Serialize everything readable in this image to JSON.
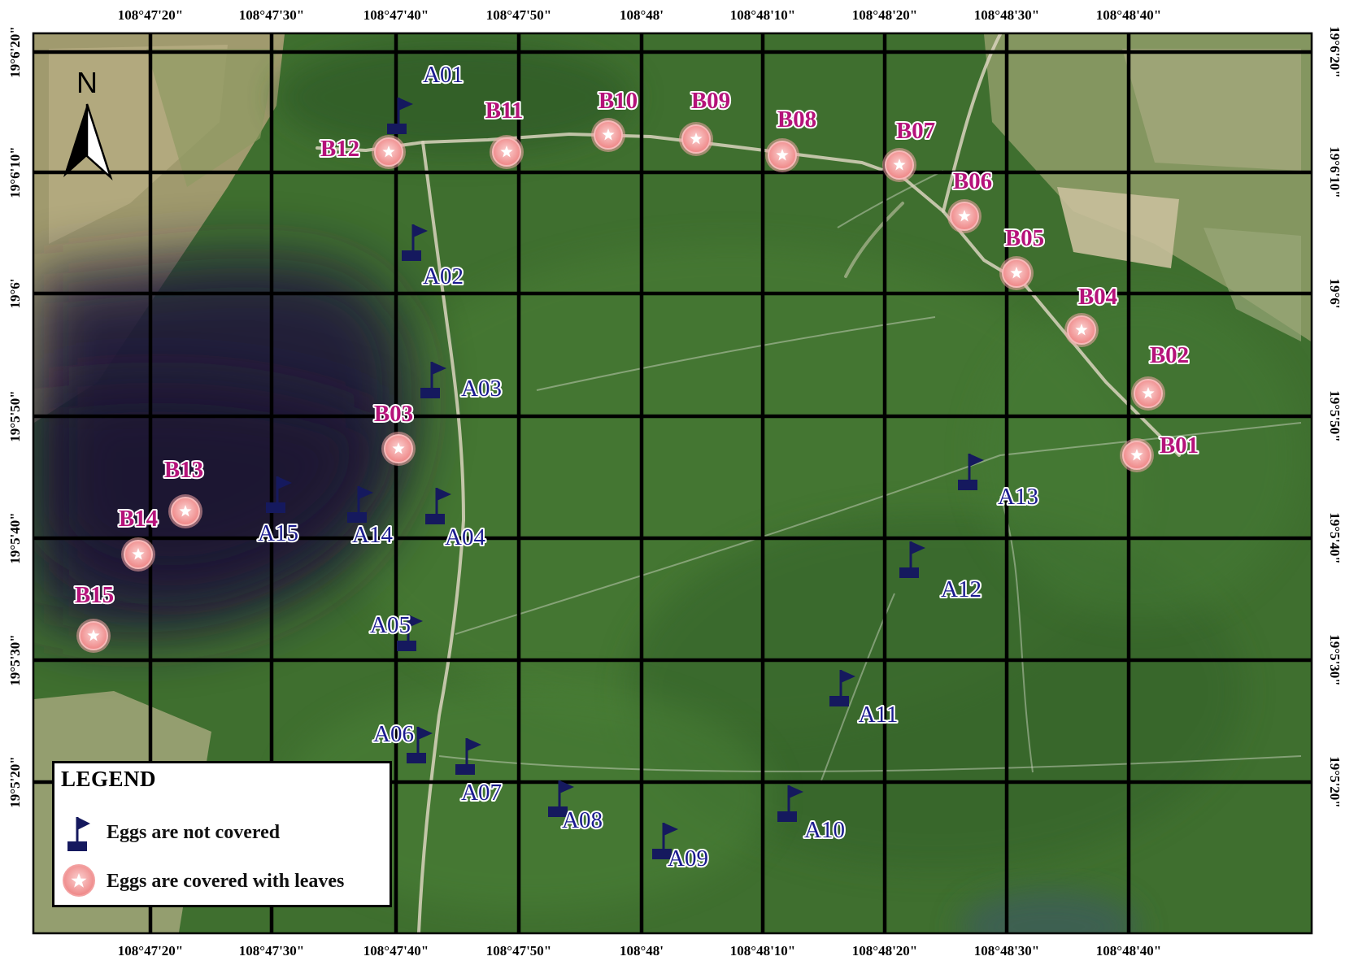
{
  "map": {
    "longitude_labels": [
      "108°47'20\"",
      "108°47'30\"",
      "108°47'40\"",
      "108°47'50\"",
      "108°48'",
      "108°48'10\"",
      "108°48'20\"",
      "108°48'30\"",
      "108°48'40\""
    ],
    "latitude_labels": [
      "19°6'20\"",
      "19°6'10\"",
      "19°6'",
      "19°5'50\"",
      "19°5'40\"",
      "19°5'30\"",
      "19°5'20\""
    ],
    "north_label": "N",
    "colors": {
      "satellite_green": "#3f6f2f",
      "shaded_area": "#241d3a",
      "flag": "#15195e",
      "marker": "#f08b8b",
      "marker_label": "#b5127a",
      "flag_label": "#1b1b8f",
      "grid": "#000000"
    }
  },
  "sites_not_covered": [
    {
      "id": "A01",
      "label": "A01",
      "icon": "flag-icon"
    },
    {
      "id": "A02",
      "label": "A02",
      "icon": "flag-icon"
    },
    {
      "id": "A03",
      "label": "A03",
      "icon": "flag-icon"
    },
    {
      "id": "A04",
      "label": "A04",
      "icon": "flag-icon"
    },
    {
      "id": "A05",
      "label": "A05",
      "icon": "flag-icon"
    },
    {
      "id": "A06",
      "label": "A06",
      "icon": "flag-icon"
    },
    {
      "id": "A07",
      "label": "A07",
      "icon": "flag-icon"
    },
    {
      "id": "A08",
      "label": "A08",
      "icon": "flag-icon"
    },
    {
      "id": "A09",
      "label": "A09",
      "icon": "flag-icon"
    },
    {
      "id": "A10",
      "label": "A10",
      "icon": "flag-icon"
    },
    {
      "id": "A11",
      "label": "A11",
      "icon": "flag-icon"
    },
    {
      "id": "A12",
      "label": "A12",
      "icon": "flag-icon"
    },
    {
      "id": "A13",
      "label": "A13",
      "icon": "flag-icon"
    },
    {
      "id": "A14",
      "label": "A14",
      "icon": "flag-icon"
    },
    {
      "id": "A15",
      "label": "A15",
      "icon": "flag-icon"
    }
  ],
  "sites_covered": [
    {
      "id": "B01",
      "label": "B01",
      "icon": "star-circle-icon"
    },
    {
      "id": "B02",
      "label": "B02",
      "icon": "star-circle-icon"
    },
    {
      "id": "B03",
      "label": "B03",
      "icon": "star-circle-icon"
    },
    {
      "id": "B04",
      "label": "B04",
      "icon": "star-circle-icon"
    },
    {
      "id": "B05",
      "label": "B05",
      "icon": "star-circle-icon"
    },
    {
      "id": "B06",
      "label": "B06",
      "icon": "star-circle-icon"
    },
    {
      "id": "B07",
      "label": "B07",
      "icon": "star-circle-icon"
    },
    {
      "id": "B08",
      "label": "B08",
      "icon": "star-circle-icon"
    },
    {
      "id": "B09",
      "label": "B09",
      "icon": "star-circle-icon"
    },
    {
      "id": "B10",
      "label": "B10",
      "icon": "star-circle-icon"
    },
    {
      "id": "B11",
      "label": "B11",
      "icon": "star-circle-icon"
    },
    {
      "id": "B12",
      "label": "B12",
      "icon": "star-circle-icon"
    },
    {
      "id": "B13",
      "label": "B13",
      "icon": "star-circle-icon"
    },
    {
      "id": "B14",
      "label": "B14",
      "icon": "star-circle-icon"
    },
    {
      "id": "B15",
      "label": "B15",
      "icon": "star-circle-icon"
    }
  ],
  "legend": {
    "title": "LEGEND",
    "not_covered": "Eggs are not covered",
    "covered": "Eggs are covered with leaves"
  }
}
